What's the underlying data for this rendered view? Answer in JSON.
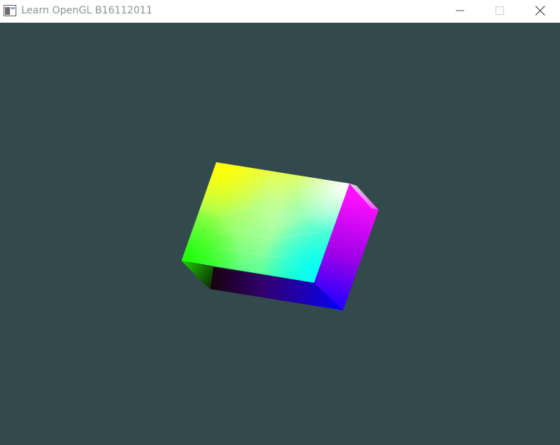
{
  "window": {
    "title": "Learn OpenGL B16112011"
  },
  "viewport": {
    "clear_color": "#334A4D",
    "object": "colored-cube"
  },
  "controls": {
    "minimize_icon": "minimize-icon",
    "maximize_icon": "maximize-icon",
    "close_icon": "close-icon"
  }
}
